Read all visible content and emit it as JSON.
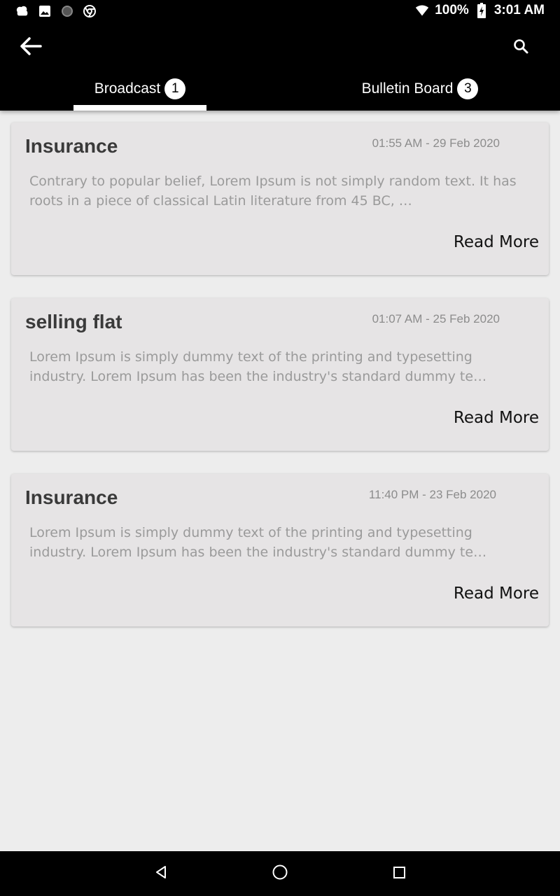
{
  "status_bar": {
    "battery": "100%",
    "time": "3:01 AM",
    "icons": [
      "notification-icon",
      "image-icon",
      "circle-icon",
      "chrome-icon",
      "wifi-icon",
      "battery-icon"
    ]
  },
  "app_bar": {
    "icons": [
      "back-arrow-icon",
      "search-icon"
    ],
    "tabs": [
      {
        "label": "Broadcast",
        "badge": "1",
        "selected": true
      },
      {
        "label": "Bulletin Board",
        "badge": "3",
        "selected": false
      }
    ]
  },
  "posts": [
    {
      "title": "Insurance",
      "date": "01:55 AM - 29 Feb 2020",
      "body": "Contrary to popular belief, Lorem Ipsum is not simply random text. It has roots in a piece of classical Latin literature from 45 BC, …",
      "action": "Read More"
    },
    {
      "title": "selling flat",
      "date": "01:07 AM - 25 Feb 2020",
      "body": "Lorem Ipsum is simply dummy text of the printing and typesetting industry. Lorem Ipsum has been the industry's standard dummy te…",
      "action": "Read More"
    },
    {
      "title": "Insurance",
      "date": "11:40 PM - 23 Feb 2020",
      "body": "Lorem Ipsum is simply dummy text of the printing and typesetting industry. Lorem Ipsum has been the industry's standard dummy te…",
      "action": "Read More"
    }
  ],
  "nav_bar": {
    "icons": [
      "back-triangle-icon",
      "home-circle-icon",
      "recents-square-icon"
    ]
  },
  "colors": {
    "bar_background": "#000000",
    "page_background": "#ededed",
    "card_background": "#e6e4e5"
  }
}
